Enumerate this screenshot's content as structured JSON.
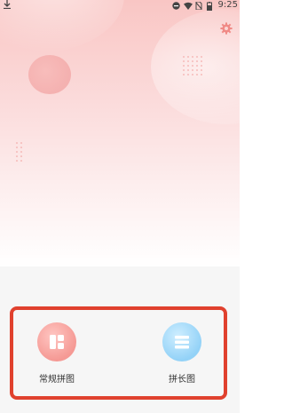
{
  "status_bar": {
    "left_icon": "download-arrow-icon",
    "right_icons": [
      "do-not-disturb-icon",
      "wifi-icon",
      "no-sim-icon",
      "battery-icon"
    ],
    "time": "9:25"
  },
  "header": {
    "settings_icon": "gear-icon"
  },
  "options": [
    {
      "label": "常规拼图",
      "icon": "grid-collage-icon",
      "color": "#f59994"
    },
    {
      "label": "拼长图",
      "icon": "long-image-icon",
      "color": "#93d2f7"
    }
  ],
  "colors": {
    "highlight_border": "#e0412e",
    "hero_top": "#f9c6c4",
    "panel_bg": "#f6f6f6"
  }
}
